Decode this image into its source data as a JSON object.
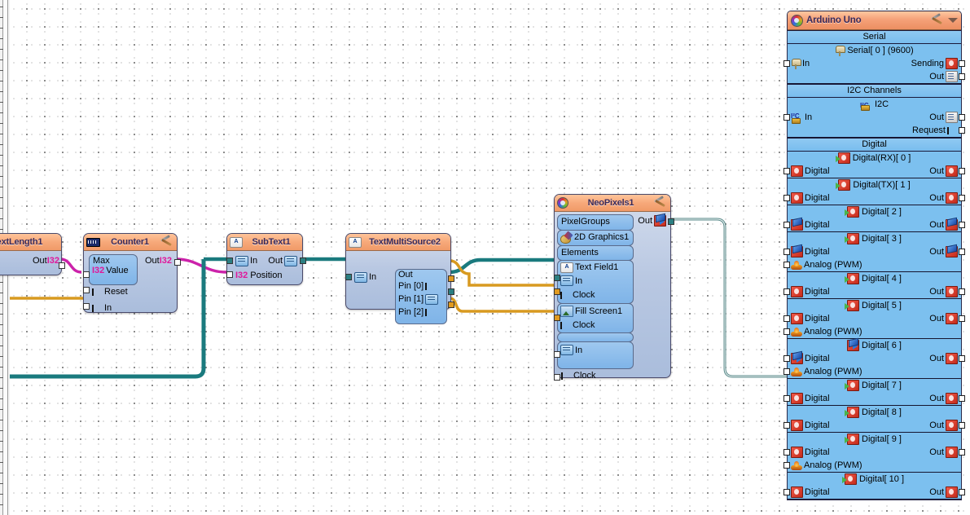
{
  "canvas": {
    "background": "#ffffff",
    "grid_dot_color": "#6e6e6e",
    "grid_spacing_px": 22
  },
  "colors": {
    "node_header": "#f2a077",
    "node_body": "#b9c8e2",
    "arduino_body": "#7cc0ef",
    "wire_text": "#1a7a7e",
    "wire_clock": "#d89a20",
    "wire_int32": "#cc22aa",
    "port_fill": "#ffffff"
  },
  "nodes": {
    "text_length": {
      "title": "extLength1",
      "outputs": [
        {
          "label": "Out",
          "type": "I32"
        }
      ]
    },
    "counter": {
      "title": "Counter1",
      "icon": "chip-icon",
      "group_label": "Max",
      "group_value_label": "Value",
      "group_value_type": "I32",
      "inputs": [
        {
          "label": "Reset",
          "type": "clock"
        },
        {
          "label": "In",
          "type": "clock"
        }
      ],
      "outputs": [
        {
          "label": "Out",
          "type": "I32"
        }
      ]
    },
    "subtext": {
      "title": "SubText1",
      "icon": "abc-icon",
      "inputs": [
        {
          "label": "In",
          "type": "text"
        },
        {
          "label": "Position",
          "type": "I32"
        }
      ],
      "outputs": [
        {
          "label": "Out",
          "type": "text"
        }
      ]
    },
    "textmultisource": {
      "title": "TextMultiSource2",
      "icon": "abc-icon",
      "inputs": [
        {
          "label": "In",
          "type": "text"
        }
      ],
      "out_group_label": "Out",
      "pins": [
        {
          "label": "Pin [0]",
          "type": "clock"
        },
        {
          "label": "Pin [1]",
          "type": "text"
        },
        {
          "label": "Pin [2]",
          "type": "clock"
        }
      ]
    },
    "neopixels": {
      "title": "NeoPixels1",
      "icon": "ring-icon",
      "pixelgroups_label": "PixelGroups",
      "graphics_label": "2D Graphics1",
      "elements_label": "Elements",
      "textfield": {
        "label": "Text Field1",
        "inputs": [
          {
            "label": "In",
            "type": "text"
          },
          {
            "label": "Clock",
            "type": "clock"
          }
        ]
      },
      "fillscreen": {
        "label": "Fill Screen1",
        "inputs": [
          {
            "label": "Clock",
            "type": "clock"
          }
        ]
      },
      "group_in_label": "In",
      "bottom_clock_label": "Clock",
      "outputs": [
        {
          "label": "Out",
          "type": "digital"
        }
      ]
    }
  },
  "arduino": {
    "title": "Arduino Uno",
    "header_icons": [
      "tools-icon",
      "chevron-down-icon"
    ],
    "sections": [
      {
        "name": "Serial",
        "blocks": [
          {
            "name": "Serial[ 0 ] (9600)",
            "icon": "pin-icon",
            "left": [
              {
                "label": "In",
                "icon": "pin-icon"
              }
            ],
            "right": [
              {
                "label": "Sending",
                "icon": "door-icon"
              },
              {
                "label": "Out",
                "icon": "sheet-icon"
              }
            ]
          }
        ]
      },
      {
        "name": "I2C Channels",
        "blocks": [
          {
            "name": "I2C",
            "icon": "i2c-icon",
            "left": [
              {
                "label": "In",
                "icon": "i2c-icon"
              }
            ],
            "right": [
              {
                "label": "Out",
                "icon": "sheet-icon"
              },
              {
                "label": "Request",
                "icon": "clock-icon"
              }
            ]
          }
        ]
      },
      {
        "name": "Digital",
        "blocks": [
          {
            "name": "Digital(RX)[ 0 ]",
            "icon": "door-green-arrow-icon",
            "left": [
              {
                "label": "Digital",
                "icon": "door-icon"
              }
            ],
            "right": [
              {
                "label": "Out",
                "icon": "door-icon"
              }
            ]
          },
          {
            "name": "Digital(TX)[ 1 ]",
            "icon": "door-green-arrow-icon",
            "left": [
              {
                "label": "Digital",
                "icon": "door-icon"
              }
            ],
            "right": [
              {
                "label": "Out",
                "icon": "door-icon"
              }
            ]
          },
          {
            "name": "Digital[ 2 ]",
            "icon": "door-green-arrow-icon",
            "left": [
              {
                "label": "Digital",
                "icon": "door-blue-icon"
              }
            ],
            "right": [
              {
                "label": "Out",
                "icon": "door-blue-icon"
              }
            ]
          },
          {
            "name": "Digital[ 3 ]",
            "icon": "door-green-arrow-icon",
            "left": [
              {
                "label": "Digital",
                "icon": "door-blue-icon"
              },
              {
                "label": "Analog (PWM)",
                "icon": "flame-icon"
              }
            ],
            "right": [
              {
                "label": "Out",
                "icon": "door-blue-icon"
              }
            ]
          },
          {
            "name": "Digital[ 4 ]",
            "icon": "door-green-arrow-icon",
            "left": [
              {
                "label": "Digital",
                "icon": "door-icon"
              }
            ],
            "right": [
              {
                "label": "Out",
                "icon": "door-icon"
              }
            ]
          },
          {
            "name": "Digital[ 5 ]",
            "icon": "door-green-arrow-icon",
            "left": [
              {
                "label": "Digital",
                "icon": "door-icon"
              },
              {
                "label": "Analog (PWM)",
                "icon": "flame-icon"
              }
            ],
            "right": [
              {
                "label": "Out",
                "icon": "door-icon"
              }
            ]
          },
          {
            "name": "Digital[ 6 ]",
            "icon": "door-blue-arrow-icon",
            "connected": true,
            "left": [
              {
                "label": "Digital",
                "icon": "door-blue-arrow-icon"
              },
              {
                "label": "Analog (PWM)",
                "icon": "flame-icon"
              }
            ],
            "right": [
              {
                "label": "Out",
                "icon": "door-icon"
              }
            ]
          },
          {
            "name": "Digital[ 7 ]",
            "icon": "door-green-arrow-icon",
            "left": [
              {
                "label": "Digital",
                "icon": "door-icon"
              }
            ],
            "right": [
              {
                "label": "Out",
                "icon": "door-icon"
              }
            ]
          },
          {
            "name": "Digital[ 8 ]",
            "icon": "door-green-arrow-icon",
            "left": [
              {
                "label": "Digital",
                "icon": "door-icon"
              }
            ],
            "right": [
              {
                "label": "Out",
                "icon": "door-icon"
              }
            ]
          },
          {
            "name": "Digital[ 9 ]",
            "icon": "door-green-arrow-icon",
            "left": [
              {
                "label": "Digital",
                "icon": "door-icon"
              },
              {
                "label": "Analog (PWM)",
                "icon": "flame-icon"
              }
            ],
            "right": [
              {
                "label": "Out",
                "icon": "door-icon"
              }
            ]
          },
          {
            "name": "Digital[ 10 ]",
            "icon": "door-green-arrow-icon",
            "left": [
              {
                "label": "Digital",
                "icon": "door-icon"
              }
            ],
            "right": [
              {
                "label": "Out",
                "icon": "door-icon"
              }
            ]
          }
        ]
      }
    ]
  }
}
